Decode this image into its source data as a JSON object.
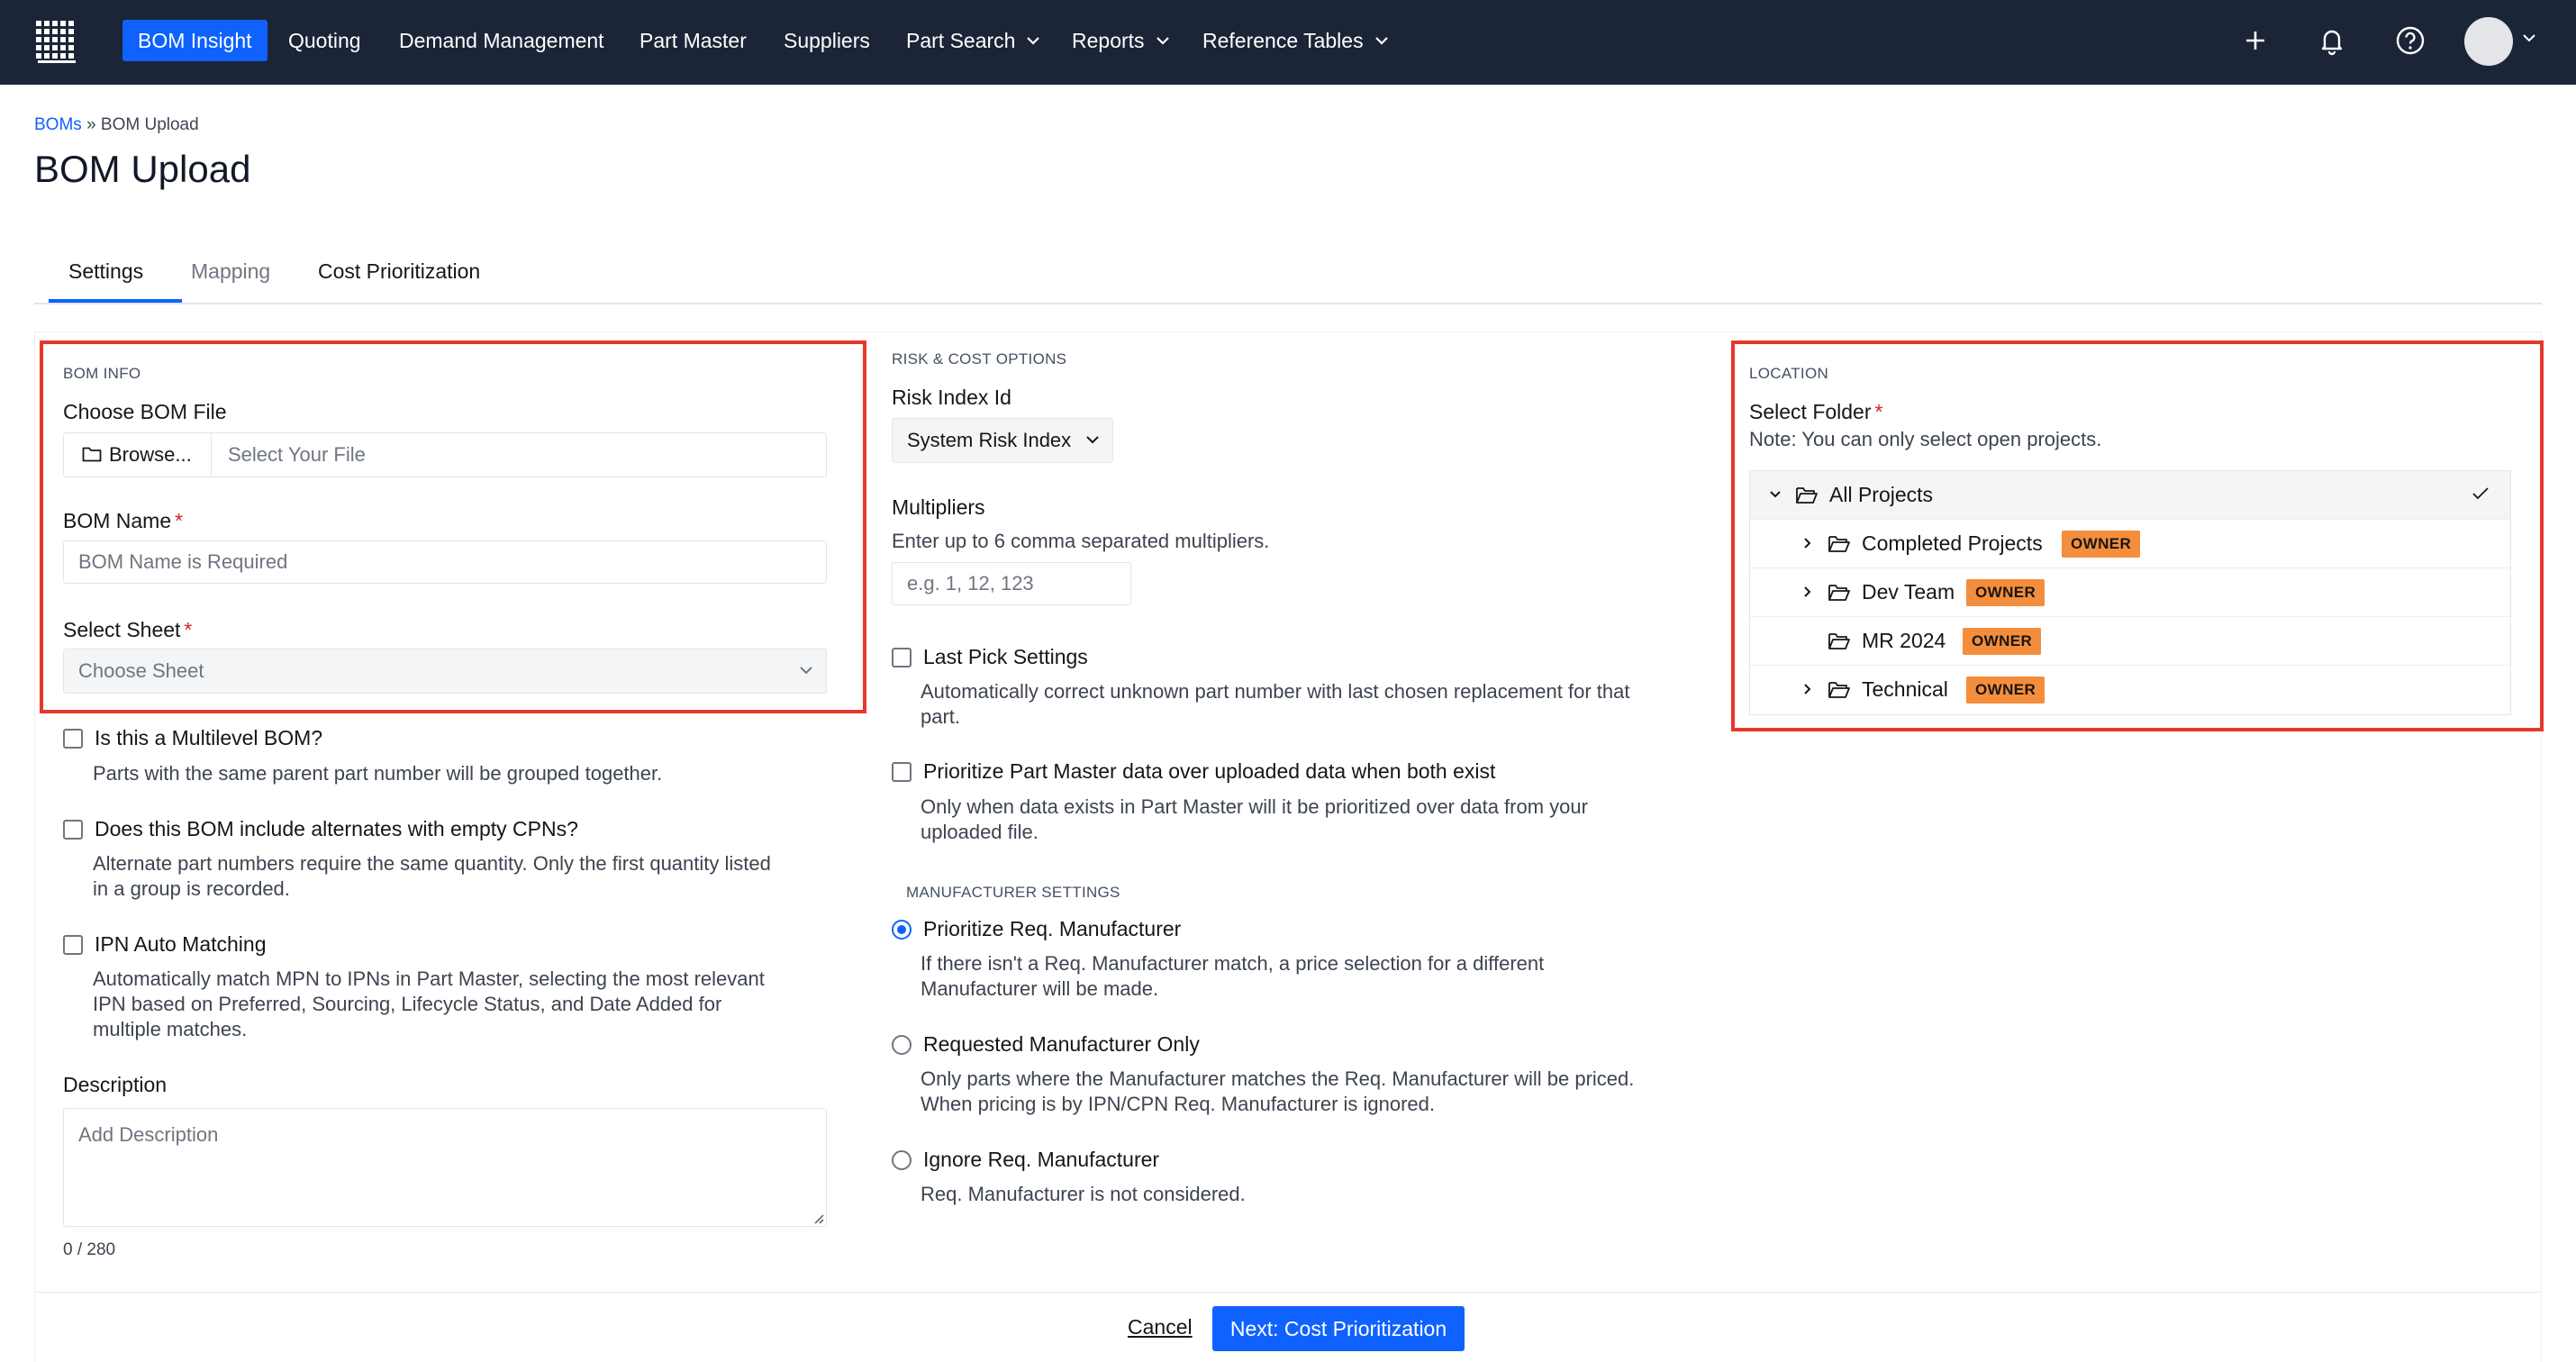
{
  "nav": {
    "items": [
      {
        "label": "BOM Insight",
        "active": true
      },
      {
        "label": "Quoting"
      },
      {
        "label": "Demand Management"
      },
      {
        "label": "Part Master"
      },
      {
        "label": "Suppliers"
      },
      {
        "label": "Part Search",
        "dropdown": true
      },
      {
        "label": "Reports",
        "dropdown": true
      },
      {
        "label": "Reference Tables",
        "dropdown": true
      }
    ],
    "icons": [
      "grid-logo-icon",
      "plus-icon",
      "bell-icon",
      "help-icon",
      "avatar",
      "chevron-down-icon"
    ]
  },
  "breadcrumb": {
    "root": "BOMs",
    "separator": "»",
    "current": "BOM Upload"
  },
  "page_title": "BOM Upload",
  "tabs": [
    {
      "label": "Settings",
      "active": true
    },
    {
      "label": "Mapping",
      "disabled": true
    },
    {
      "label": "Cost Prioritization"
    }
  ],
  "bom_info": {
    "section": "BOM INFO",
    "file_label": "Choose BOM File",
    "browse_label": "Browse...",
    "file_placeholder": "Select Your File",
    "name_label": "BOM Name",
    "name_placeholder": "BOM Name is Required",
    "sheet_label": "Select Sheet",
    "sheet_placeholder": "Choose Sheet"
  },
  "options_left": [
    {
      "label": "Is this a Multilevel BOM?",
      "help": "Parts with the same parent part number will be grouped together.",
      "checked": false
    },
    {
      "label": "Does this BOM include alternates with empty CPNs?",
      "help_lines": [
        "Alternate part numbers require the same quantity. Only the first quantity listed",
        "in a group is recorded."
      ],
      "checked": false
    },
    {
      "label": "IPN Auto Matching",
      "help_lines": [
        "Automatically match MPN to IPNs in Part Master, selecting the most relevant",
        "IPN based on Preferred, Sourcing, Lifecycle Status, and Date Added for",
        "multiple matches."
      ],
      "checked": false
    }
  ],
  "description": {
    "label": "Description",
    "placeholder": "Add Description",
    "counter": "0 / 280"
  },
  "risk_cost": {
    "section": "RISK & COST OPTIONS",
    "risk_label": "Risk Index Id",
    "risk_value": "System Risk Index",
    "multipliers_label": "Multipliers",
    "multipliers_help": "Enter up to 6 comma separated multipliers.",
    "multipliers_placeholder": "e.g. 1, 12, 123",
    "last_pick_label": "Last Pick Settings",
    "last_pick_help_lines": [
      "Automatically correct unknown part number with last chosen replacement for that",
      "part."
    ],
    "prioritize_pm_label": "Prioritize Part Master data over uploaded data when both exist",
    "prioritize_pm_help_lines": [
      "Only when data exists in Part Master will it be prioritized over data from your",
      "uploaded file."
    ]
  },
  "manufacturer": {
    "section": "MANUFACTURER SETTINGS",
    "options": [
      {
        "label": "Prioritize Req. Manufacturer",
        "help_lines": [
          "If there isn't a Req. Manufacturer match, a price selection for a different",
          "Manufacturer will be made."
        ],
        "selected": true
      },
      {
        "label": "Requested Manufacturer Only",
        "help_lines": [
          "Only parts where the Manufacturer matches the Req. Manufacturer will be priced.",
          "When pricing is by IPN/CPN Req. Manufacturer is ignored."
        ],
        "selected": false
      },
      {
        "label": "Ignore Req. Manufacturer",
        "help_lines": [
          "Req. Manufacturer is not considered."
        ],
        "selected": false
      }
    ]
  },
  "location": {
    "section": "LOCATION",
    "folder_label": "Select Folder",
    "note": "Note: You can only select open projects.",
    "tree": [
      {
        "label": "All Projects",
        "expanded": true,
        "selected": true
      },
      {
        "label": "Completed Projects",
        "badge": "OWNER",
        "expandable": true
      },
      {
        "label": "Dev Team",
        "badge": "OWNER",
        "expandable": true
      },
      {
        "label": "MR 2024",
        "badge": "OWNER",
        "expandable": false
      },
      {
        "label": "Technical",
        "badge": "OWNER",
        "expandable": true
      }
    ]
  },
  "footer": {
    "cancel": "Cancel",
    "next": "Next: Cost Prioritization"
  },
  "colors": {
    "nav_bg": "#1b2537",
    "primary": "#0f62fe",
    "owner_badge": "#f48d3c",
    "highlight_box": "#e8372a"
  }
}
